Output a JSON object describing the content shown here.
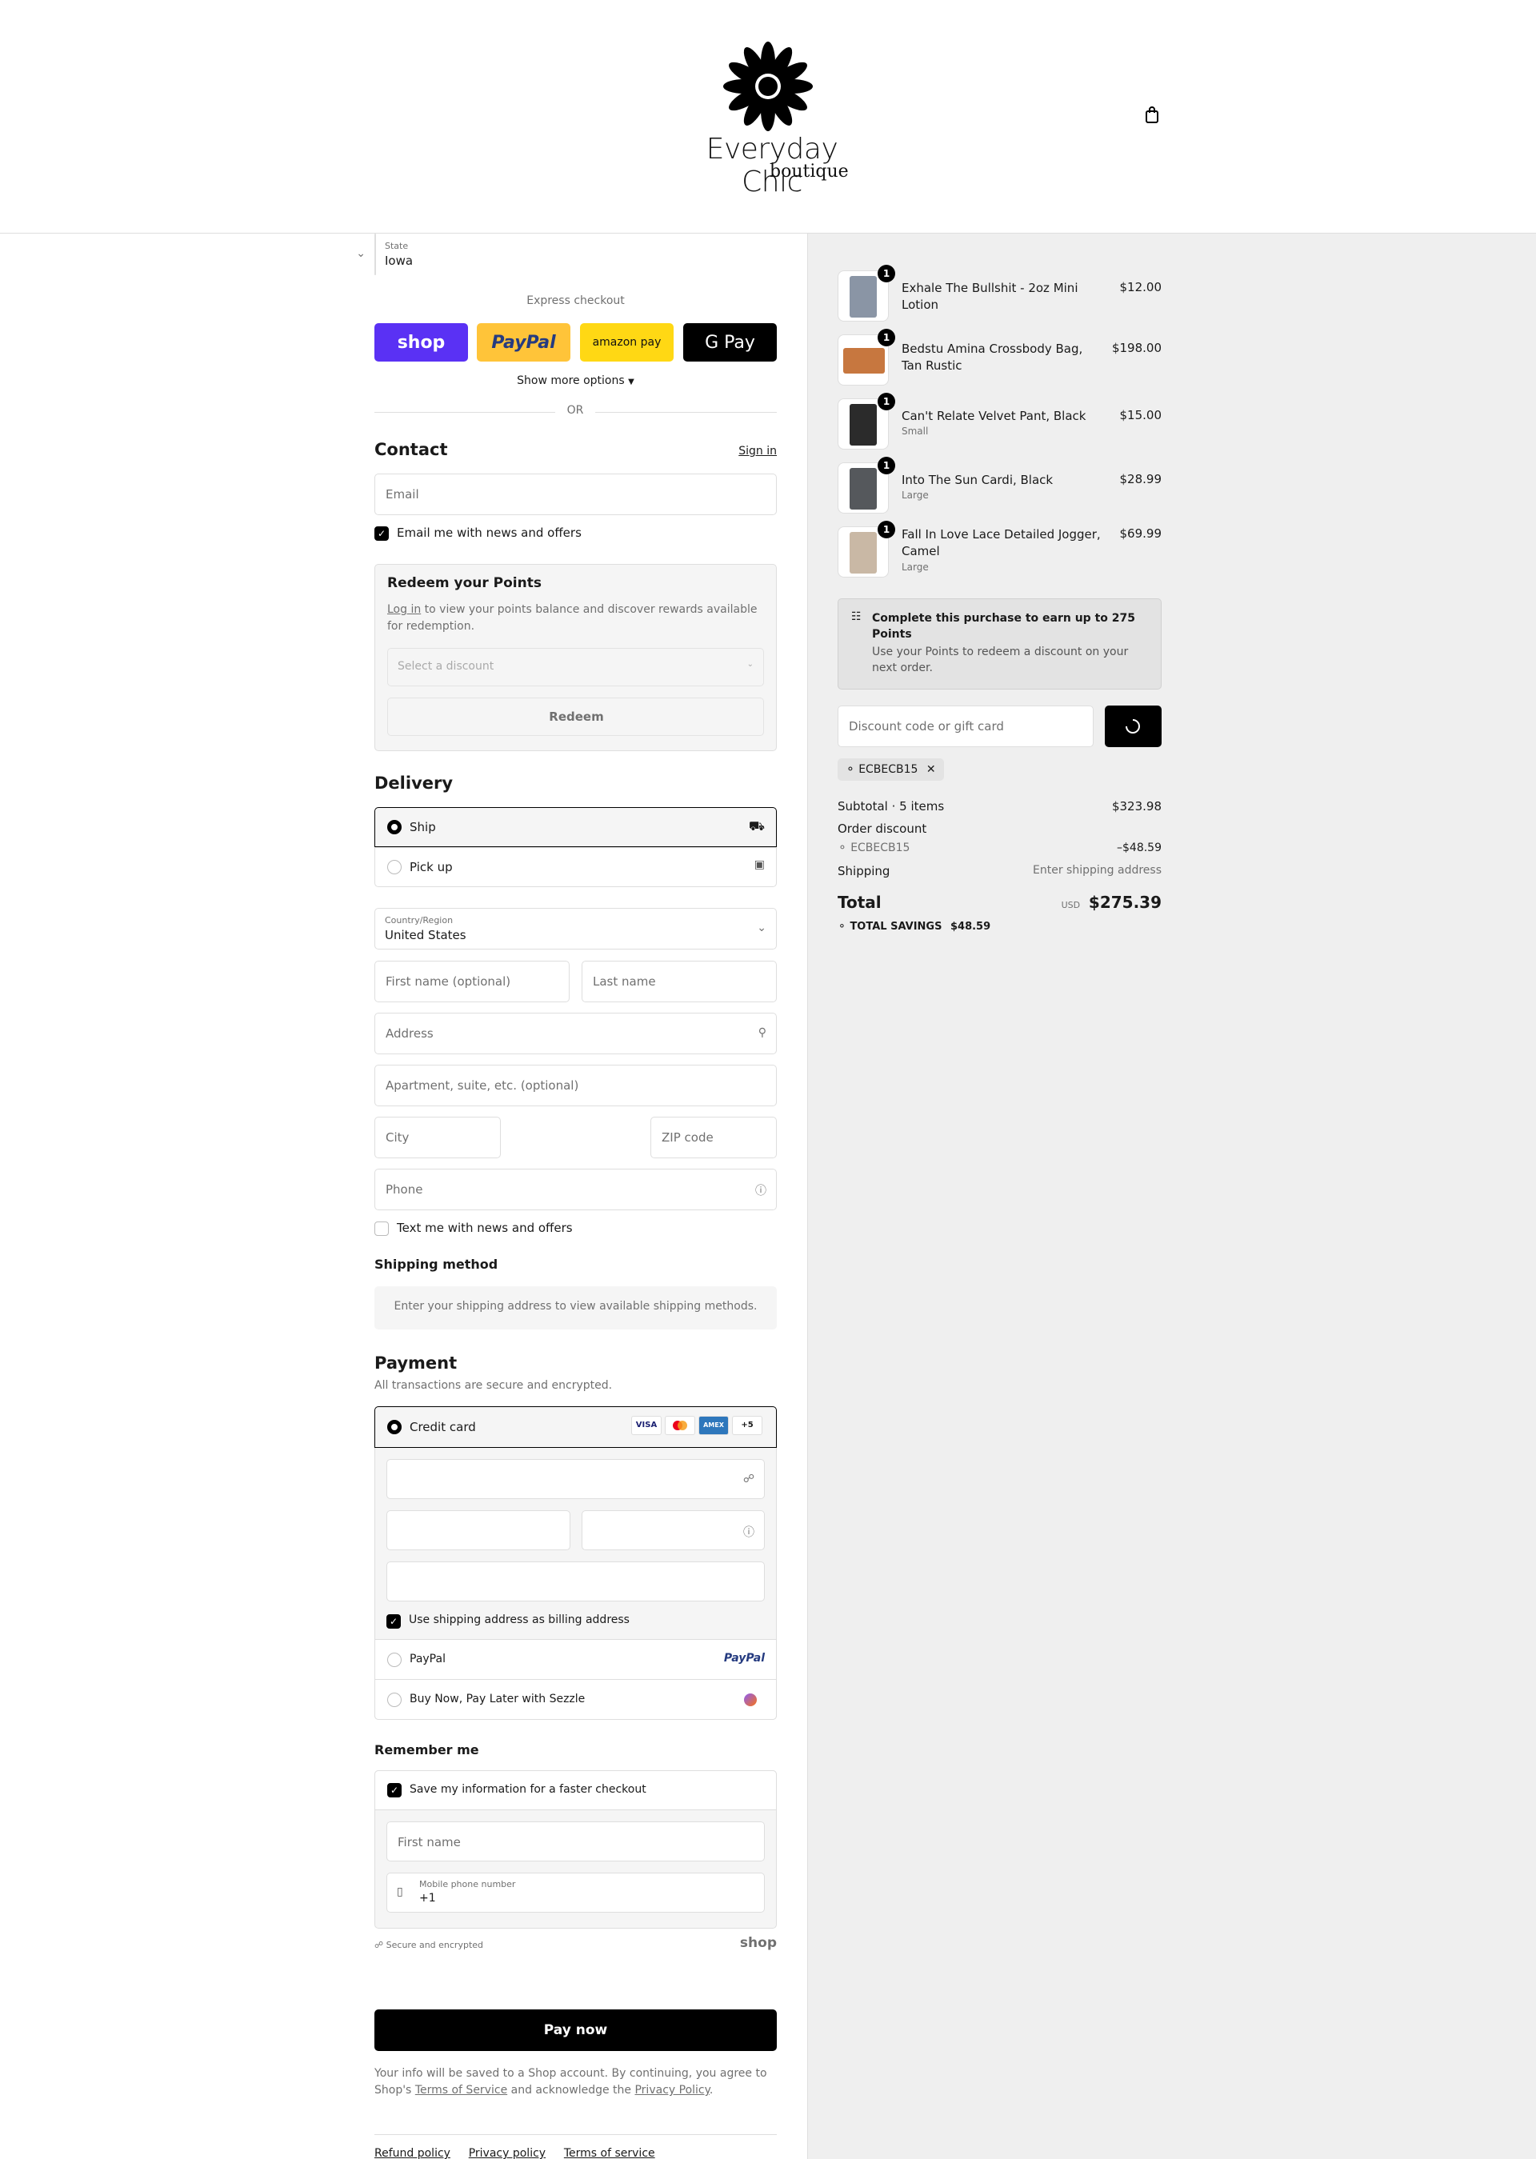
{
  "brand": {
    "name": "Everyday Chic",
    "sub": "boutique"
  },
  "express": {
    "title": "Express checkout",
    "buttons": [
      "shop",
      "PayPal",
      "amazon pay",
      "G Pay"
    ],
    "show_more": "Show more options",
    "or": "OR"
  },
  "contact": {
    "title": "Contact",
    "sign_in": "Sign in",
    "email_placeholder": "Email",
    "newsletter_label": "Email me with news and offers"
  },
  "points": {
    "title": "Redeem your Points",
    "login_link": "Log in",
    "desc": "to view your points balance and discover rewards available for redemption.",
    "select_placeholder": "Select a discount",
    "redeem_label": "Redeem"
  },
  "delivery": {
    "title": "Delivery",
    "options": [
      {
        "label": "Ship",
        "selected": true
      },
      {
        "label": "Pick up",
        "selected": false
      }
    ],
    "country_label": "Country/Region",
    "country_value": "United States",
    "first_name_ph": "First name (optional)",
    "last_name_ph": "Last name",
    "address_ph": "Address",
    "apartment_ph": "Apartment, suite, etc. (optional)",
    "city_ph": "City",
    "state_label": "State",
    "state_value": "Iowa",
    "zip_ph": "ZIP code",
    "phone_ph": "Phone",
    "sms_label": "Text me with news and offers"
  },
  "shipping_method": {
    "title": "Shipping method",
    "info": "Enter your shipping address to view available shipping methods."
  },
  "payment": {
    "title": "Payment",
    "subtitle": "All transactions are secure and encrypted.",
    "credit_card_label": "Credit card",
    "card_brands": [
      "VISA",
      "MC",
      "AMEX",
      "+5"
    ],
    "billing_label": "Use shipping address as billing address",
    "paypal_label": "PayPal",
    "paypal_logo": "PayPal",
    "sezzle_label": "Buy Now, Pay Later with Sezzle"
  },
  "remember": {
    "title": "Remember me",
    "save_label": "Save my information for a faster checkout",
    "first_name_ph": "First name",
    "mobile_label": "Mobile phone number",
    "mobile_value": "+1",
    "secure_label": "Secure and encrypted",
    "shop_logo": "shop"
  },
  "pay_now": "Pay now",
  "legal": {
    "prefix": "Your info will be saved to a Shop account. By continuing, you agree to Shop's",
    "terms": "Terms of Service",
    "middle": "and acknowledge the",
    "privacy": "Privacy Policy",
    "suffix": "."
  },
  "footer_links": [
    "Refund policy",
    "Privacy policy",
    "Terms of service"
  ],
  "cart": {
    "items": [
      {
        "qty": "1",
        "name": "Exhale The Bullshit - 2oz Mini Lotion",
        "variant": "",
        "price": "$12.00",
        "color": "#8a95a5"
      },
      {
        "qty": "1",
        "name": "Bedstu Amina Crossbody Bag, Tan Rustic",
        "variant": "",
        "price": "$198.00",
        "color": "#c7773f"
      },
      {
        "qty": "1",
        "name": "Can't Relate Velvet Pant, Black",
        "variant": "Small",
        "price": "$15.00",
        "color": "#2b2b2b"
      },
      {
        "qty": "1",
        "name": "Into The Sun Cardi, Black",
        "variant": "Large",
        "price": "$28.99",
        "color": "#55585c"
      },
      {
        "qty": "1",
        "name": "Fall In Love Lace Detailed Jogger, Camel",
        "variant": "Large",
        "price": "$69.99",
        "color": "#c9b8a5"
      }
    ],
    "earn_title": "Complete this purchase to earn up to 275 Points",
    "earn_desc": "Use your Points to redeem a discount on your next order.",
    "discount_ph": "Discount code or gift card",
    "code_tag": "ECBECB15",
    "subtotal_label": "Subtotal · 5 items",
    "subtotal_value": "$323.98",
    "order_discount_label": "Order discount",
    "discount_code": "ECBECB15",
    "discount_value": "–$48.59",
    "shipping_label": "Shipping",
    "shipping_value": "Enter shipping address",
    "total_label": "Total",
    "currency": "USD",
    "total_value": "$275.39",
    "savings_label": "TOTAL SAVINGS",
    "savings_value": "$48.59"
  }
}
